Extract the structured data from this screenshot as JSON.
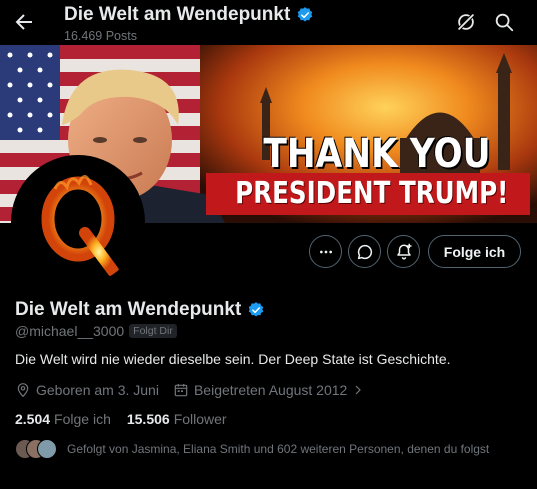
{
  "header": {
    "title": "Die Welt am Wendepunkt",
    "posts": "16.469 Posts",
    "back_icon": "arrow-left-icon",
    "icons": [
      "grok-icon",
      "search-icon"
    ]
  },
  "banner": {
    "line1": "THANK YOU",
    "line2": "PRESIDENT TRUMP!"
  },
  "avatar": {
    "letter": "Q"
  },
  "actions": {
    "more_icon": "more-icon",
    "message_icon": "message-icon",
    "notify_icon": "notify-plus-icon",
    "follow_label": "Folge ich"
  },
  "profile": {
    "name": "Die Welt am Wendepunkt",
    "handle": "@michael__3000",
    "follows_you": "Folgt Dir",
    "bio": "Die Welt wird nie wieder dieselbe sein. Der Deep State ist Geschichte.",
    "location": "Geboren am 3. Juni",
    "joined": "Beigetreten August 2012",
    "following_count": "2.504",
    "following_label": "Folge ich",
    "followers_count": "15.506",
    "followers_label": "Follower",
    "followed_by": "Gefolgt von Jasmina, Eliana Smith und 602 weiteren Personen, denen du folgst"
  },
  "colors": {
    "background": "#000000",
    "text": "#e7e9ea",
    "muted": "#71767b",
    "verified": "#1d9bf0",
    "border": "#536471"
  }
}
